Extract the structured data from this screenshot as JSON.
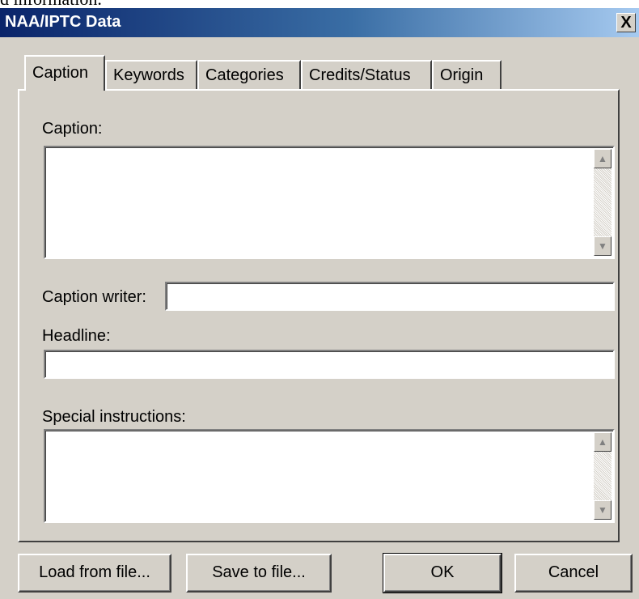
{
  "behind_text": "d information.",
  "window": {
    "title": "NAA/IPTC Data",
    "close_label": "X"
  },
  "tabs": [
    {
      "label": "Caption",
      "active": true
    },
    {
      "label": "Keywords",
      "active": false
    },
    {
      "label": "Categories",
      "active": false
    },
    {
      "label": "Credits/Status",
      "active": false
    },
    {
      "label": "Origin",
      "active": false
    }
  ],
  "form": {
    "caption": {
      "label": "Caption:",
      "value": ""
    },
    "caption_writer": {
      "label": "Caption writer:",
      "value": ""
    },
    "headline": {
      "label": "Headline:",
      "value": ""
    },
    "special_instructions": {
      "label": "Special instructions:",
      "value": ""
    }
  },
  "scroll_icons": {
    "up": "scroll-up-arrow",
    "down": "scroll-down-arrow"
  },
  "buttons": {
    "load": "Load from file...",
    "save": "Save to file...",
    "ok": "OK",
    "cancel": "Cancel"
  }
}
